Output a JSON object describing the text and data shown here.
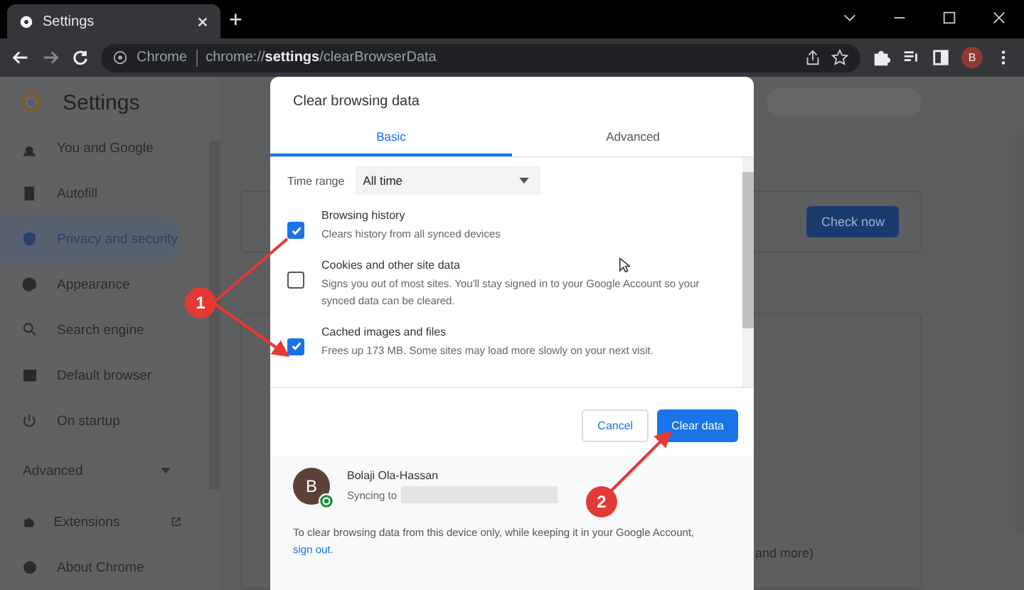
{
  "tab_strip": {
    "tab_title": "Settings",
    "new_tab": "+"
  },
  "toolbar": {
    "site_label": "Chrome",
    "url": "chrome://**settings**/clearBrowserData",
    "profile_initial": "B"
  },
  "sidebar": {
    "title": "Settings",
    "items": [
      {
        "label": "You and Google",
        "selected": false
      },
      {
        "label": "Autofill",
        "selected": false
      },
      {
        "label": "Privacy and security",
        "selected": true
      },
      {
        "label": "Appearance",
        "selected": false
      },
      {
        "label": "Search engine",
        "selected": false
      },
      {
        "label": "Default browser",
        "selected": false
      },
      {
        "label": "On startup",
        "selected": false
      }
    ],
    "advanced": "Advanced",
    "extra_items": [
      {
        "label": "Extensions"
      },
      {
        "label": "About Chrome"
      }
    ]
  },
  "background": {
    "check_button": "Check now",
    "partial_text": "and more)"
  },
  "dialog": {
    "title": "Clear browsing data",
    "tabs": [
      {
        "label": "Basic",
        "selected": true
      },
      {
        "label": "Advanced",
        "selected": false
      }
    ],
    "time_range": {
      "label": "Time range",
      "value": "All time"
    },
    "options": [
      {
        "title": "Browsing history",
        "description": "Clears history from all synced devices",
        "checked": true
      },
      {
        "title": "Cookies and other site data",
        "description": "Signs you out of most sites. You'll stay signed in to your Google Account so your synced data can be cleared.",
        "checked": false
      },
      {
        "title": "Cached images and files",
        "description": "Frees up 173 MB. Some sites may load more slowly on your next visit.",
        "checked": true
      }
    ],
    "cancel": "Cancel",
    "confirm": "Clear data",
    "account": {
      "initial": "B",
      "name": "Bolaji Ola-Hassan",
      "syncing": "Syncing to"
    },
    "footer": {
      "text": "To clear browsing data from this device only, while keeping it in your Google Account, ",
      "link": "sign out",
      "end": "."
    }
  },
  "annotations": [
    {
      "label": "1"
    },
    {
      "label": "2"
    }
  ]
}
